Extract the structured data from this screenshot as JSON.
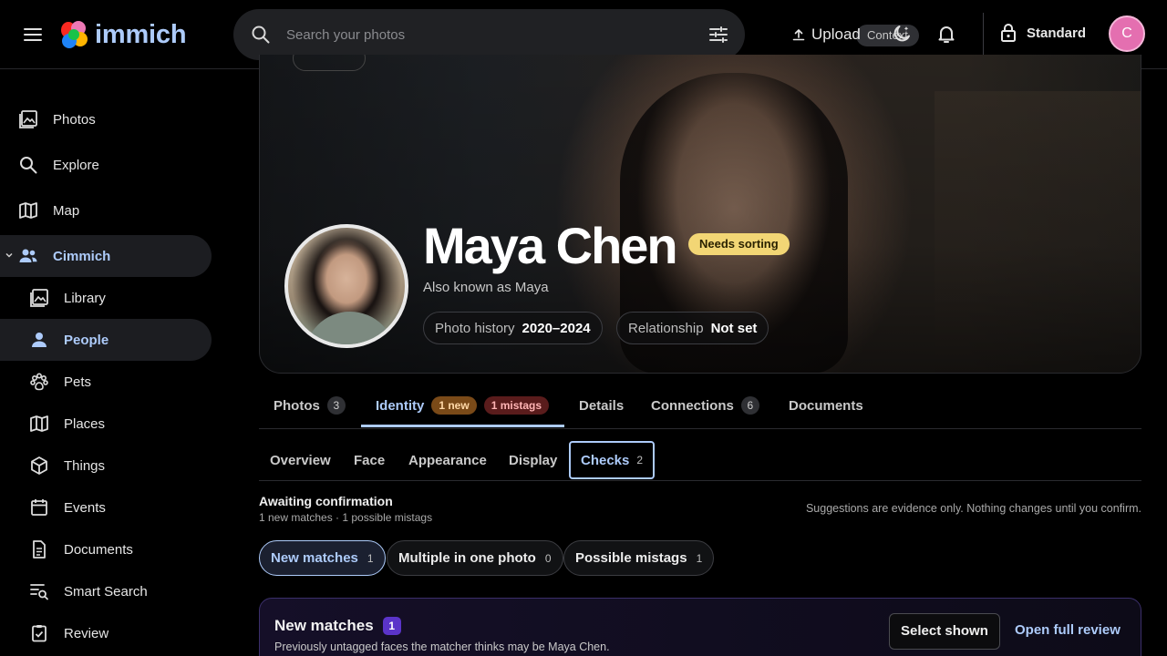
{
  "app": {
    "name": "immich"
  },
  "search": {
    "placeholder": "Search your photos",
    "context_label": "Context"
  },
  "header": {
    "upload_label": "Upload",
    "lock_label": "Standard",
    "avatar_initial": "C"
  },
  "sidebar": {
    "items": [
      {
        "label": "Photos",
        "icon": "photos-icon"
      },
      {
        "label": "Explore",
        "icon": "search-icon"
      },
      {
        "label": "Map",
        "icon": "map-icon"
      },
      {
        "label": "Cimmich",
        "icon": "people-group-icon"
      },
      {
        "label": "Library",
        "icon": "photos-icon"
      },
      {
        "label": "People",
        "icon": "person-icon"
      },
      {
        "label": "Pets",
        "icon": "paw-icon"
      },
      {
        "label": "Places",
        "icon": "map-icon"
      },
      {
        "label": "Things",
        "icon": "cube-icon"
      },
      {
        "label": "Events",
        "icon": "calendar-icon"
      },
      {
        "label": "Documents",
        "icon": "document-icon"
      },
      {
        "label": "Smart Search",
        "icon": "smart-search-icon"
      },
      {
        "label": "Review",
        "icon": "clipboard-check-icon"
      }
    ]
  },
  "person": {
    "name": "Maya Chen",
    "status_badge": "Needs sorting",
    "aka": "Also known as Maya",
    "photo_history_label": "Photo history",
    "photo_history_value": "2020–2024",
    "relationship_label": "Relationship",
    "relationship_value": "Not set"
  },
  "tabs": {
    "photos": {
      "label": "Photos",
      "count": "3"
    },
    "identity": {
      "label": "Identity",
      "new_badge": "1 new",
      "mistag_badge": "1 mistags"
    },
    "details": {
      "label": "Details"
    },
    "connections": {
      "label": "Connections",
      "count": "6"
    },
    "documents": {
      "label": "Documents"
    }
  },
  "subtabs": {
    "overview": "Overview",
    "face": "Face",
    "appearance": "Appearance",
    "display": "Display",
    "checks": {
      "label": "Checks",
      "count": "2"
    }
  },
  "awaiting": {
    "title": "Awaiting confirmation",
    "subtitle": "1 new matches · 1 possible mistags",
    "note": "Suggestions are evidence only. Nothing changes until you confirm."
  },
  "filters": [
    {
      "label": "New matches",
      "count": "1"
    },
    {
      "label": "Multiple in one photo",
      "count": "0"
    },
    {
      "label": "Possible mistags",
      "count": "1"
    }
  ],
  "match_card": {
    "title": "New matches",
    "count": "1",
    "subtitle": "Previously untagged faces the matcher thinks may be Maya Chen.",
    "select_label": "Select shown",
    "review_label": "Open full review"
  },
  "colors": {
    "accent": "#adcbfa",
    "badge_yellow": "#f2d675",
    "avatar": "#e46fb0"
  }
}
